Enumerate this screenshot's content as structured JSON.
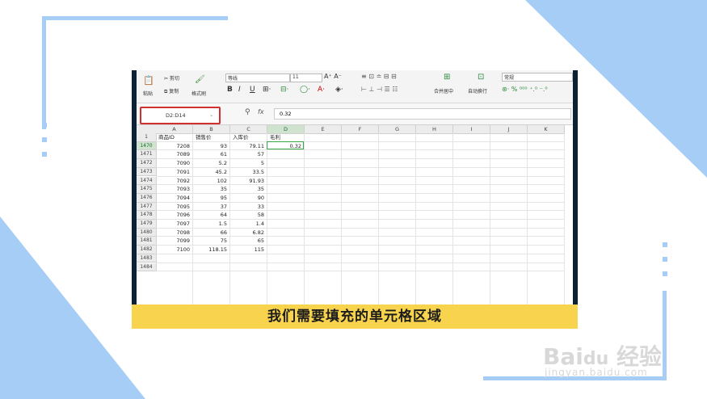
{
  "ribbon": {
    "paste": "粘贴",
    "cut": "剪切",
    "copy": "复制",
    "format_painter": "格式刷",
    "font_name": "等线",
    "font_size": "11",
    "merge_center": "合并居中",
    "wrap_text": "自动换行",
    "number_format": "常规"
  },
  "formula_bar": {
    "name_box": "D2:D14",
    "fx": "fx",
    "value": "0.32"
  },
  "columns": [
    "A",
    "B",
    "C",
    "D",
    "E",
    "F",
    "G",
    "H",
    "I",
    "J",
    "K"
  ],
  "headers_row": [
    "商品ID",
    "销售价",
    "入库价",
    "毛利"
  ],
  "row_numbers": [
    "1",
    "1470",
    "1471",
    "1472",
    "1473",
    "1474",
    "1475",
    "1476",
    "1477",
    "1478",
    "1479",
    "1480",
    "1481",
    "1482",
    "1483",
    "1484"
  ],
  "rows": [
    [
      "7208",
      "93",
      "79.11",
      "0.32"
    ],
    [
      "7089",
      "61",
      "57",
      ""
    ],
    [
      "7090",
      "5.2",
      "5",
      ""
    ],
    [
      "7091",
      "45.2",
      "33.5",
      ""
    ],
    [
      "7092",
      "102",
      "91.93",
      ""
    ],
    [
      "7093",
      "35",
      "35",
      ""
    ],
    [
      "7094",
      "95",
      "90",
      ""
    ],
    [
      "7095",
      "37",
      "33",
      ""
    ],
    [
      "7096",
      "64",
      "58",
      ""
    ],
    [
      "7097",
      "1.5",
      "1.4",
      ""
    ],
    [
      "7098",
      "66",
      "6.82",
      ""
    ],
    [
      "7099",
      "75",
      "65",
      ""
    ],
    [
      "7100",
      "118.15",
      "115",
      ""
    ]
  ],
  "caption": "我们需要填充的单元格区域",
  "watermark": {
    "brand": "Bai du 经验",
    "url": "jingyan.baidu.com"
  },
  "colors": {
    "accent_blue": "#9ec8f5",
    "caption_bg": "#f8d34e",
    "selection_red": "#d03030",
    "active_green": "#3aa64a"
  }
}
